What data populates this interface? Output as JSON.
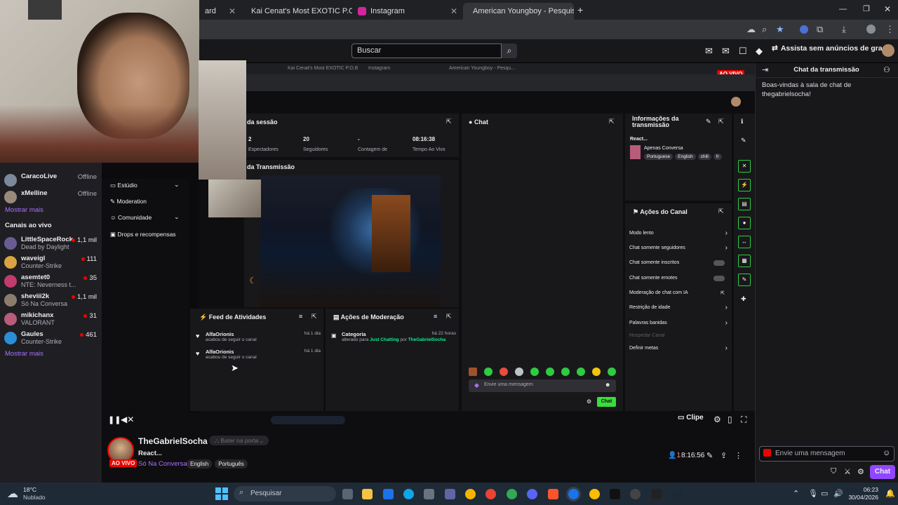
{
  "browser": {
    "tabs": [
      {
        "label": "ard"
      },
      {
        "label": "Kai Cenat's Most EXOTIC P.O. B"
      },
      {
        "label": "Instagram"
      },
      {
        "label": "American Youngboy - Pesquisa"
      }
    ],
    "new_tab": "+"
  },
  "twitch": {
    "search_placeholder": "Buscar",
    "turbo": "Assista sem anúncios de graça"
  },
  "sidebar": {
    "offline": [
      {
        "name": "CaracoLive",
        "status": "Offline",
        "color": "#7b8a9a"
      },
      {
        "name": "xMelline",
        "status": "Offline",
        "color": "#9a8a7a"
      }
    ],
    "show_more_1": "Mostrar mais",
    "live_header": "Canais ao vivo",
    "live": [
      {
        "name": "LittleSpaceRock",
        "game": "Dead by Daylight",
        "viewers": "1,1 mil",
        "color": "#6b5b95"
      },
      {
        "name": "waveigl",
        "game": "Counter-Strike",
        "viewers": "111",
        "color": "#d9a441"
      },
      {
        "name": "asemtet0",
        "game": "NTE: Neverness t...",
        "viewers": "35",
        "color": "#c23b6b"
      },
      {
        "name": "sheviii2k",
        "game": "Só Na Conversa",
        "viewers": "1,1 mil",
        "color": "#8a7d6b"
      },
      {
        "name": "mikichanx",
        "game": "VALORANT",
        "viewers": "31",
        "color": "#b85c7a"
      },
      {
        "name": "Gaules",
        "game": "Counter-Strike",
        "viewers": "461",
        "color": "#2a8fd6"
      }
    ],
    "show_more_2": "Mostrar mais"
  },
  "dashboard": {
    "inner_tabs": [
      "Kai Cenat's Most EXOTIC P.O.B",
      "Instagram",
      "American Youngboy - Pesqu..."
    ],
    "ao_vivo": "AO VIVO",
    "session_title": "da sessão",
    "stats": [
      {
        "value": "2",
        "label": "Espectadores"
      },
      {
        "value": "20",
        "label": "Seguidores"
      },
      {
        "value": "-",
        "label": "Contagem de"
      },
      {
        "value": "08:16:38",
        "label": "Tempo Ao Vivo"
      }
    ],
    "preview_title": "da Transmissão",
    "menu": [
      "Estúdio",
      "Moderation",
      "Comunidade",
      "Drops e recompensas"
    ],
    "activity_title": "Feed de Atividades",
    "activities": [
      {
        "user": "AlfaOrionis",
        "text": "acabou de seguir o canal",
        "time": "há 1 dia"
      },
      {
        "user": "AlfaOrionis",
        "text": "acabou de seguir o canal",
        "time": "há 1 dia"
      }
    ],
    "modactions_title": "Ações de Moderação",
    "modaction": {
      "title": "Categoria",
      "time": "há 22 horas",
      "text_a": "alterado para",
      "cat": "Just Chatting",
      "text_b": "por",
      "by": "TheGabrielSocha"
    },
    "chat_title": "Chat",
    "chat_placeholder": "Envie uma mensagem",
    "chat_button": "Chat",
    "info_title": "Informações da transmissão",
    "stream_title": "React...",
    "category": "Apenas Conversa",
    "tags": [
      "Portuguese",
      "English",
      "chill",
      "fr"
    ],
    "actions_title": "Ações do Canal",
    "actions": [
      "Modo lento",
      "Chat somente seguidores",
      "Chat somente inscritos",
      "Chat somente emotes",
      "Moderação de chat com IA",
      "Restrição de idade",
      "Palavras banidas",
      "Hospedar Canal",
      "Definir metas"
    ]
  },
  "player": {
    "clip": "Clipe"
  },
  "stream_info": {
    "channel": "TheGabrielSocha",
    "title": "React...",
    "live": "AO VIVO",
    "category": "Só Na Conversa",
    "tags": [
      "English",
      "Português"
    ],
    "viewers": "1",
    "uptime": "8:16:56",
    "bater": "Bater na porta"
  },
  "chat": {
    "title": "Chat da transmissão",
    "welcome": "Boas-vindas à sala de chat de thegabrielsocha!",
    "placeholder": "Envie uma mensagem",
    "send": "Chat"
  },
  "taskbar": {
    "temp": "18°C",
    "weather": "Nublado",
    "search": "Pesquisar",
    "time": "06:23",
    "date": "30/04/2026"
  }
}
